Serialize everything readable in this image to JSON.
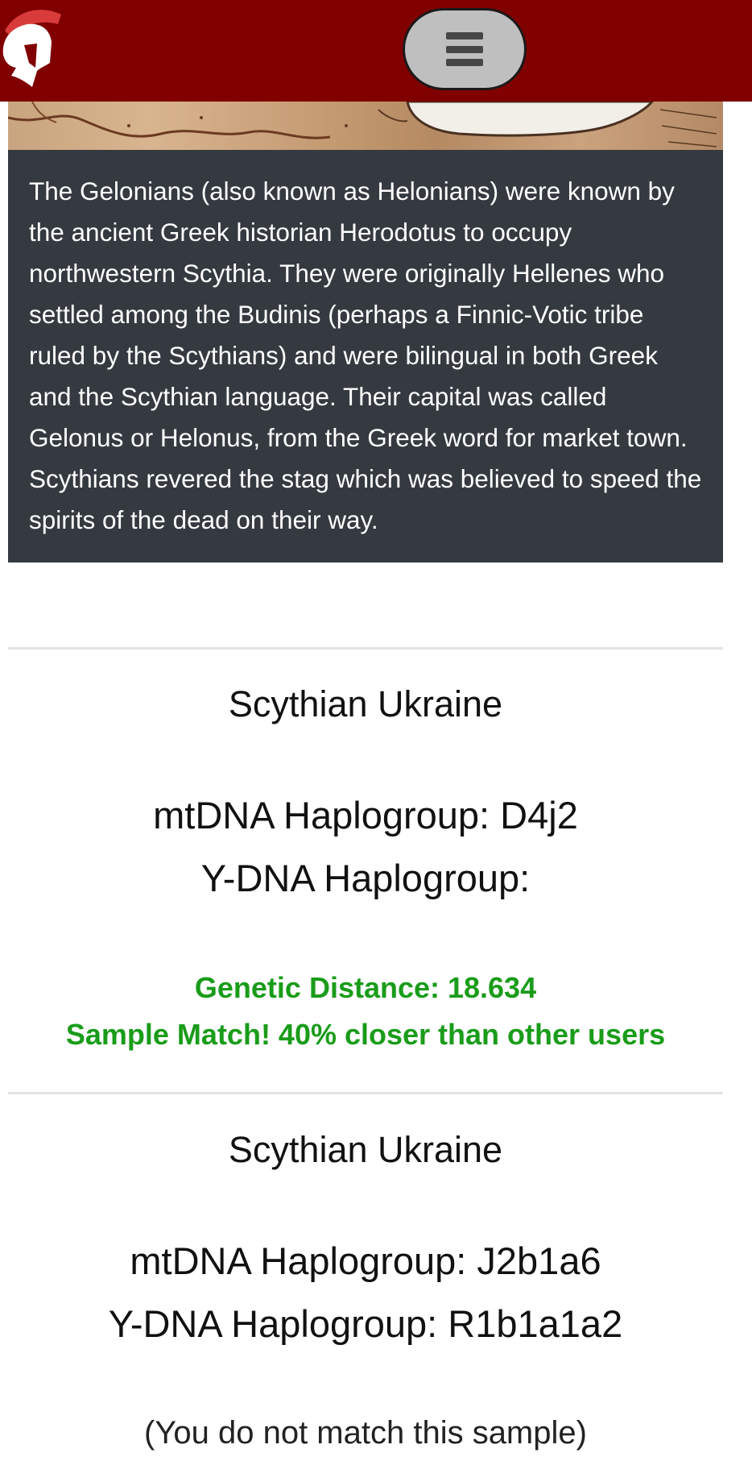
{
  "header": {
    "logo_icon": "spartan-helmet-icon",
    "menu_icon": "hamburger-menu-icon",
    "colors": {
      "header_bg": "#800000",
      "menu_bg": "#bfbfbf"
    }
  },
  "caption": {
    "text": "The Gelonians (also known as Helonians) were known by the ancient Greek historian Herodotus to occupy northwestern Scythia. They were originally Hellenes who settled among the Budinis (perhaps a Finnic-Votic tribe ruled by the Scythians) and were bilingual in both Greek and the Scythian language. Their capital was called Gelonus or Helonus, from the Greek word for market town. Scythians revered the stag which was believed to speed the spirits of the dead on their way."
  },
  "samples": [
    {
      "title": "Scythian Ukraine",
      "mtdna": "mtDNA Haplogroup: D4j2",
      "ydna": "Y-DNA Haplogroup:",
      "distance": "Genetic Distance: 18.634",
      "match": "Sample Match! 40% closer than other users"
    },
    {
      "title": "Scythian Ukraine",
      "mtdna": "mtDNA Haplogroup: J2b1a6",
      "ydna": "Y-DNA Haplogroup: R1b1a1a2",
      "match": "(You do not match this sample)"
    }
  ],
  "colors": {
    "match_green": "#1a9c1a",
    "caption_bg": "#343a40"
  }
}
